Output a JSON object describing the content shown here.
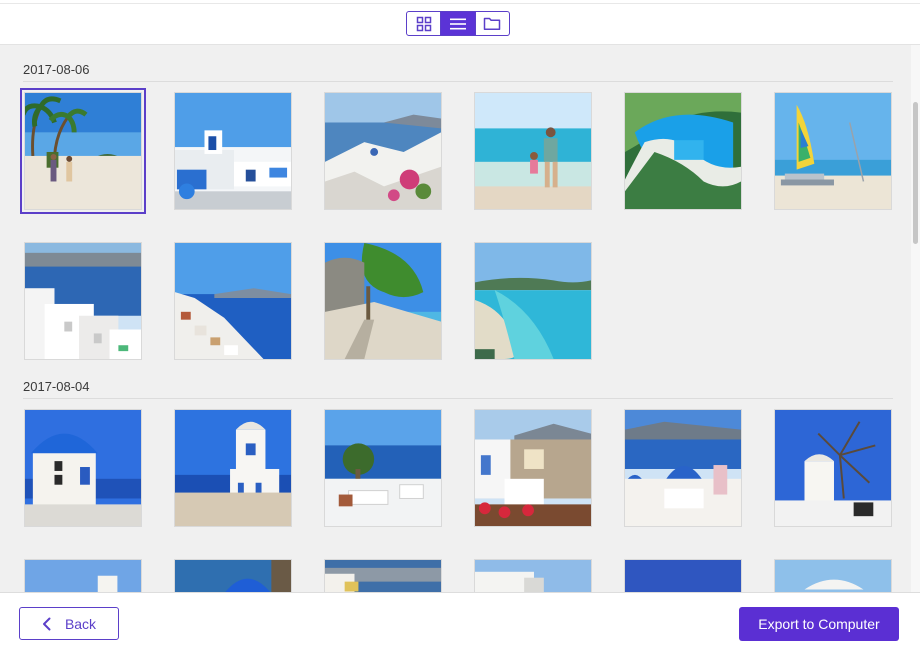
{
  "toolbar": {
    "views": [
      {
        "icon": "grid-view-icon",
        "active": false
      },
      {
        "icon": "list-view-icon",
        "active": true
      },
      {
        "icon": "folder-view-icon",
        "active": false
      }
    ],
    "accent_color": "#5b33d6"
  },
  "groups": [
    {
      "date": "2017-08-06",
      "photos": [
        {
          "scene": "palm-beach-couple",
          "selected": true
        },
        {
          "scene": "santorini-blue-dome-pool",
          "selected": false
        },
        {
          "scene": "santorini-village-flowers",
          "selected": false
        },
        {
          "scene": "beach-father-child",
          "selected": false
        },
        {
          "scene": "navagio-cove",
          "selected": false
        },
        {
          "scene": "catamaran-beach",
          "selected": false
        },
        {
          "scene": "santorini-white-houses",
          "selected": false
        },
        {
          "scene": "santorini-cliff-sea",
          "selected": false
        },
        {
          "scene": "tree-path-beach",
          "selected": false
        },
        {
          "scene": "turquoise-bay",
          "selected": false
        }
      ]
    },
    {
      "date": "2017-08-04",
      "photos": [
        {
          "scene": "blue-dome-chapel",
          "selected": false
        },
        {
          "scene": "bell-tower-sea",
          "selected": false
        },
        {
          "scene": "terrace-sofa-sea",
          "selected": false
        },
        {
          "scene": "oia-roses",
          "selected": false
        },
        {
          "scene": "blue-domes-caldera",
          "selected": false
        },
        {
          "scene": "windmill",
          "selected": false
        }
      ]
    },
    {
      "date": "",
      "photos": [
        {
          "scene": "white-church-sky",
          "selected": false
        },
        {
          "scene": "blue-dome-top",
          "selected": false
        },
        {
          "scene": "cliff-village",
          "selected": false
        },
        {
          "scene": "white-houses-sky",
          "selected": false
        },
        {
          "scene": "deep-blue-sky",
          "selected": false
        },
        {
          "scene": "umbrella-sky",
          "selected": false
        }
      ]
    }
  ],
  "footer": {
    "back_label": "Back",
    "export_label": "Export to Computer"
  }
}
